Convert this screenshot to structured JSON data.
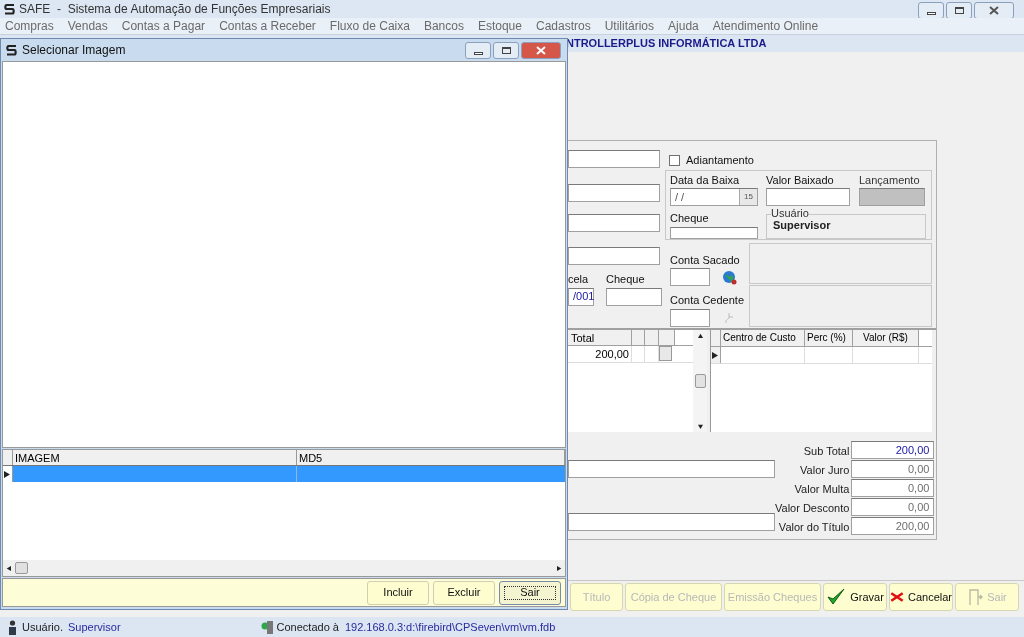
{
  "window": {
    "title": "SAFE  -  Sistema de Automação de Funções Empresariais"
  },
  "menu": [
    "Compras",
    "Vendas",
    "Contas a Pagar",
    "Contas a Receber",
    "Fluxo de Caixa",
    "Bancos",
    "Estoque",
    "Cadastros",
    "Utilitários",
    "Ajuda",
    "Atendimento Online"
  ],
  "company": "NTROLLERPLUS INFORMÁTICA LTDA",
  "dialog": {
    "title": "Selecionar Imagem",
    "columns": [
      "IMAGEM",
      "MD5"
    ],
    "rows": [
      {
        "selected": true
      }
    ],
    "buttons": [
      {
        "label": "Incluir",
        "focused": false
      },
      {
        "label": "Excluir",
        "focused": false
      },
      {
        "label": "Sair",
        "focused": true
      }
    ]
  },
  "form": {
    "parcela": {
      "label": "cela",
      "value": "/001"
    },
    "cheque_left": {
      "label": "Cheque"
    },
    "adiantamento": {
      "label": "Adiantamento",
      "checked": false
    },
    "data_baixa": {
      "label": "Data da Baixa",
      "value": "/ /",
      "button": "15"
    },
    "valor_baixado": {
      "label": "Valor Baixado"
    },
    "lancamento": {
      "label": "Lançamento",
      "disabled": true
    },
    "cheque": {
      "label": "Cheque"
    },
    "usuario": {
      "label": "Usuário",
      "value": "Supervisor"
    },
    "conta_sacado": {
      "label": "Conta Sacado"
    },
    "conta_cedente": {
      "label": "Conta Cedente"
    }
  },
  "items_grid": {
    "columns": [
      "Total"
    ],
    "rows": [
      {
        "total": "200,00"
      }
    ]
  },
  "cost_grid": {
    "columns": [
      "Centro de Custo",
      "Perc (%)",
      "Valor (R$)"
    ]
  },
  "totals": [
    {
      "label": "Sub Total",
      "value": "200,00",
      "emphasis": true
    },
    {
      "label": "Valor Juro",
      "value": "0,00",
      "emphasis": false
    },
    {
      "label": "Valor Multa",
      "value": "0,00",
      "emphasis": false
    },
    {
      "label": "Valor Desconto",
      "value": "0,00",
      "emphasis": false
    },
    {
      "label": "Valor do Título",
      "value": "200,00",
      "emphasis": false
    }
  ],
  "toolbar": [
    {
      "label": "Título",
      "disabled": true,
      "kind": "plain"
    },
    {
      "label": "Cópia de Cheque",
      "disabled": true,
      "kind": "plain"
    },
    {
      "label": "Emissão Cheques",
      "disabled": true,
      "kind": "plain"
    },
    {
      "label": "Gravar",
      "disabled": false,
      "kind": "check"
    },
    {
      "label": "Cancelar",
      "disabled": false,
      "kind": "cross"
    },
    {
      "label": "Sair",
      "disabled": true,
      "kind": "exit"
    }
  ],
  "status": {
    "user_label": "Usuário.",
    "user": "Supervisor",
    "conn_label": "Conectado à",
    "conn": "192.168.0.3:d:\\firebird\\CPSeven\\vm\\vm.fdb"
  }
}
